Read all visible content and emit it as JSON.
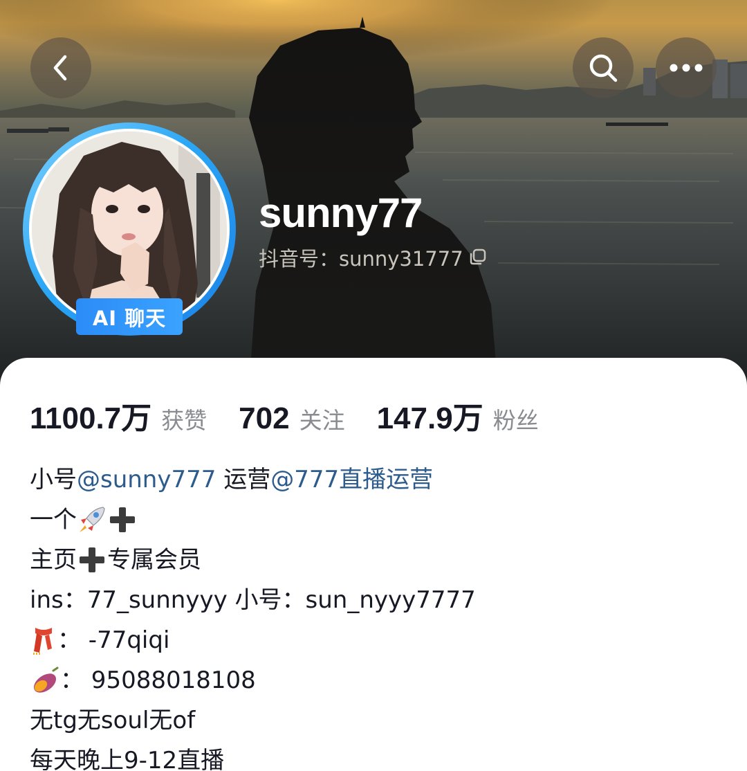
{
  "header": {
    "back_icon": "chevron-left-icon",
    "search_icon": "search-icon",
    "more_icon": "more-dots-icon"
  },
  "profile": {
    "avatar_badge": "AI 聊天",
    "username": "sunny77",
    "douyin_id": "抖音号：sunny31777",
    "copy_icon": "copy-icon"
  },
  "stats": [
    {
      "value": "1100.7万",
      "label": "获赞"
    },
    {
      "value": "702",
      "label": "关注"
    },
    {
      "value": "147.9万",
      "label": "粉丝"
    }
  ],
  "bio": {
    "line1": {
      "prefix": "小号",
      "mention1": "@sunny777",
      "middle": " 运营",
      "mention2": "@777直播运营"
    },
    "line2": {
      "text": "一个",
      "icons": [
        "rocket-emoji",
        "plus-emoji"
      ]
    },
    "line3": {
      "before": "主页",
      "after": "专属会员",
      "icon": "plus-emoji"
    },
    "line4": "ins：77_sunnyyy 小号：sun_nyyy7777",
    "line5": {
      "icon": "scarf-emoji",
      "text": "： -77qiqi"
    },
    "line6": {
      "icon": "sweet-potato-emoji",
      "text": "： 95088018108"
    },
    "line7": "无tg无soul无of",
    "line8": "每天晚上9-12直播"
  },
  "colors": {
    "mention": "#2c5b8c",
    "badge": "#2b8cf7",
    "ring": "#2aa6f5",
    "text_primary": "#161823",
    "text_secondary": "#8a8b91"
  }
}
